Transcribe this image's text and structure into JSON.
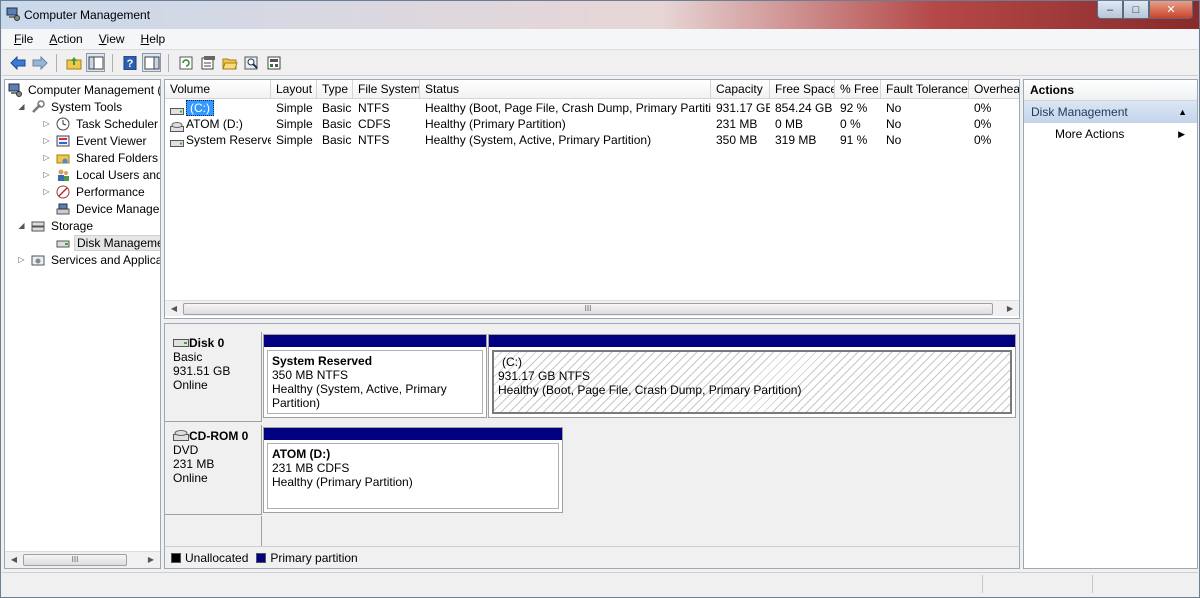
{
  "window": {
    "title": "Computer Management",
    "controls": {
      "minimize": "–",
      "maximize": "□",
      "close": "✕"
    }
  },
  "menu": [
    {
      "label": "File",
      "accel": "F",
      "rest": "ile"
    },
    {
      "label": "Action",
      "accel": "A",
      "rest": "ction"
    },
    {
      "label": "View",
      "accel": "V",
      "rest": "iew"
    },
    {
      "label": "Help",
      "accel": "H",
      "rest": "elp"
    }
  ],
  "toolbar": {
    "icons": [
      "back-icon",
      "forward-icon",
      "up-folder-icon",
      "show-hide-tree-icon",
      "help-icon",
      "show-hide-action-pane-icon",
      "refresh-icon",
      "properties-icon",
      "open-icon",
      "search-icon",
      "export-icon"
    ]
  },
  "tree": {
    "items": [
      {
        "label": "Computer Management (L",
        "icon": "computer-management-icon",
        "expander": "",
        "indent": 0
      },
      {
        "label": "System Tools",
        "icon": "tools-icon",
        "expander": "◢",
        "indent": 1
      },
      {
        "label": "Task Scheduler",
        "icon": "clock-icon",
        "expander": "▷",
        "indent": 2
      },
      {
        "label": "Event Viewer",
        "icon": "event-viewer-icon",
        "expander": "▷",
        "indent": 2
      },
      {
        "label": "Shared Folders",
        "icon": "shared-folder-icon",
        "expander": "▷",
        "indent": 2
      },
      {
        "label": "Local Users and Gro",
        "icon": "users-icon",
        "expander": "▷",
        "indent": 2
      },
      {
        "label": "Performance",
        "icon": "performance-icon",
        "expander": "▷",
        "indent": 2
      },
      {
        "label": "Device Manager",
        "icon": "device-manager-icon",
        "expander": "",
        "indent": 2
      },
      {
        "label": "Storage",
        "icon": "storage-icon",
        "expander": "◢",
        "indent": 1
      },
      {
        "label": "Disk Management",
        "icon": "disk-management-icon",
        "expander": "",
        "indent": 2,
        "selected": true
      },
      {
        "label": "Services and Applicatic",
        "icon": "services-icon",
        "expander": "▷",
        "indent": 1
      }
    ],
    "scroll_thumb_label": "III"
  },
  "volume_list": {
    "columns": [
      "Volume",
      "Layout",
      "Type",
      "File System",
      "Status",
      "Capacity",
      "Free Space",
      "% Free",
      "Fault Tolerance",
      "Overhead"
    ],
    "rows": [
      {
        "volume": "(C:)",
        "icon": "drive-icon",
        "layout": "Simple",
        "type": "Basic",
        "fs": "NTFS",
        "status": "Healthy (Boot, Page File, Crash Dump, Primary Partition)",
        "capacity": "931.17 GB",
        "free": "854.24 GB",
        "pct": "92 %",
        "fault": "No",
        "overhead": "0%"
      },
      {
        "volume": "ATOM (D:)",
        "icon": "cd-drive-icon",
        "layout": "Simple",
        "type": "Basic",
        "fs": "CDFS",
        "status": "Healthy (Primary Partition)",
        "capacity": "231 MB",
        "free": "0 MB",
        "pct": "0 %",
        "fault": "No",
        "overhead": "0%"
      },
      {
        "volume": "System Reserved",
        "icon": "drive-icon",
        "layout": "Simple",
        "type": "Basic",
        "fs": "NTFS",
        "status": "Healthy (System, Active, Primary Partition)",
        "capacity": "350 MB",
        "free": "319 MB",
        "pct": "91 %",
        "fault": "No",
        "overhead": "0%"
      }
    ],
    "scroll_thumb_label": "III"
  },
  "disks": [
    {
      "name": "Disk 0",
      "icon": "hard-disk-icon",
      "type": "Basic",
      "size": "931.51 GB",
      "state": "Online",
      "partitions": [
        {
          "name": "System Reserved",
          "size": "350 MB NTFS",
          "status": "Healthy (System, Active, Primary Partition)"
        },
        {
          "name": "(C:)",
          "size": "931.17 GB NTFS",
          "status": "Healthy (Boot, Page File, Crash Dump, Primary Partition)"
        }
      ]
    },
    {
      "name": "CD-ROM 0",
      "icon": "cd-rom-icon",
      "type": "DVD",
      "size": "231 MB",
      "state": "Online",
      "partitions": [
        {
          "name": "ATOM  (D:)",
          "size": "231 MB CDFS",
          "status": "Healthy (Primary Partition)"
        }
      ]
    }
  ],
  "legend": [
    {
      "label": "Unallocated",
      "color": "#000000"
    },
    {
      "label": "Primary partition",
      "color": "#000080"
    }
  ],
  "actions": {
    "title": "Actions",
    "section": "Disk Management",
    "items": [
      {
        "label": "More Actions"
      }
    ]
  },
  "colors": {
    "partition_bar": "#000080",
    "selection": "#3399ff",
    "actions_header": "#c3d4ea"
  }
}
